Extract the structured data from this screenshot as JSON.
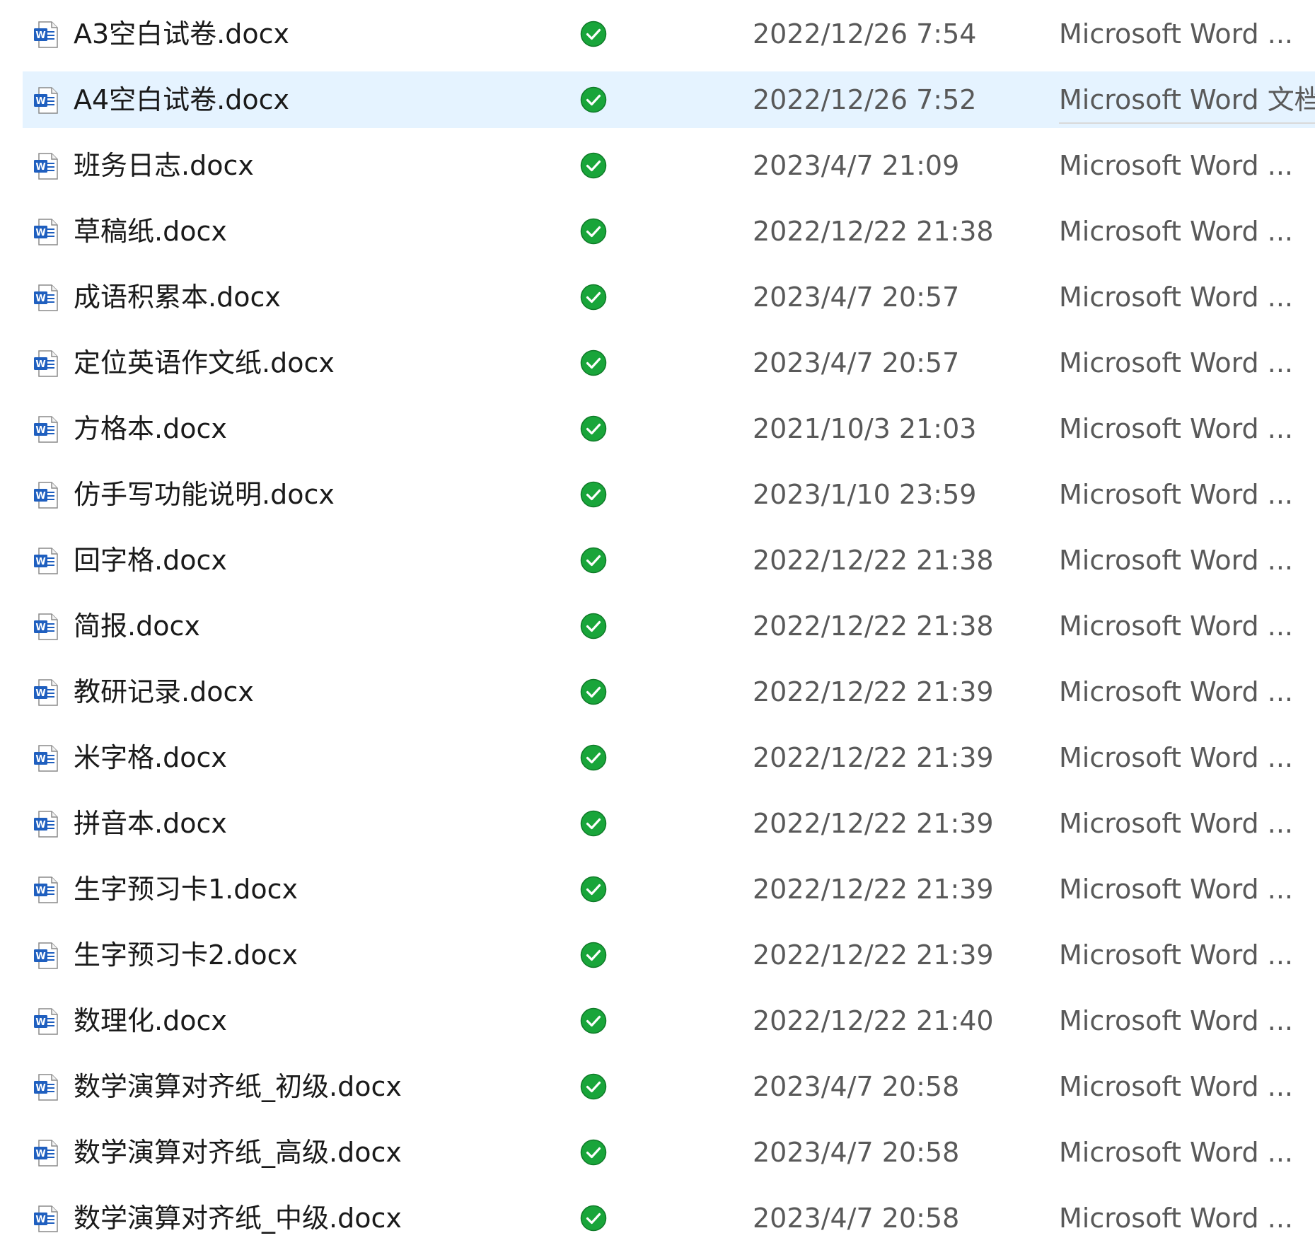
{
  "colors": {
    "selection": "#e5f3ff",
    "status_ok": "#19a53a",
    "word_blue": "#1f5fbf",
    "text": "#1a1a1a",
    "secondary_text": "#595959"
  },
  "icons": {
    "file": "word-document-icon",
    "status": "synced-check-icon"
  },
  "selected_index": 1,
  "files": [
    {
      "name": "A3空白试卷.docx",
      "modified": "2022/12/26 7:54",
      "type": "Microsoft Word ..."
    },
    {
      "name": "A4空白试卷.docx",
      "modified": "2022/12/26 7:52",
      "type": "Microsoft Word 文档"
    },
    {
      "name": "班务日志.docx",
      "modified": "2023/4/7 21:09",
      "type": "Microsoft Word ..."
    },
    {
      "name": "草稿纸.docx",
      "modified": "2022/12/22 21:38",
      "type": "Microsoft Word ..."
    },
    {
      "name": "成语积累本.docx",
      "modified": "2023/4/7 20:57",
      "type": "Microsoft Word ..."
    },
    {
      "name": "定位英语作文纸.docx",
      "modified": "2023/4/7 20:57",
      "type": "Microsoft Word ..."
    },
    {
      "name": "方格本.docx",
      "modified": "2021/10/3 21:03",
      "type": "Microsoft Word ..."
    },
    {
      "name": "仿手写功能说明.docx",
      "modified": "2023/1/10 23:59",
      "type": "Microsoft Word ..."
    },
    {
      "name": "回字格.docx",
      "modified": "2022/12/22 21:38",
      "type": "Microsoft Word ..."
    },
    {
      "name": "简报.docx",
      "modified": "2022/12/22 21:38",
      "type": "Microsoft Word ..."
    },
    {
      "name": "教研记录.docx",
      "modified": "2022/12/22 21:39",
      "type": "Microsoft Word ..."
    },
    {
      "name": "米字格.docx",
      "modified": "2022/12/22 21:39",
      "type": "Microsoft Word ..."
    },
    {
      "name": "拼音本.docx",
      "modified": "2022/12/22 21:39",
      "type": "Microsoft Word ..."
    },
    {
      "name": "生字预习卡1.docx",
      "modified": "2022/12/22 21:39",
      "type": "Microsoft Word ..."
    },
    {
      "name": "生字预习卡2.docx",
      "modified": "2022/12/22 21:39",
      "type": "Microsoft Word ..."
    },
    {
      "name": "数理化.docx",
      "modified": "2022/12/22 21:40",
      "type": "Microsoft Word ..."
    },
    {
      "name": "数学演算对齐纸_初级.docx",
      "modified": "2023/4/7 20:58",
      "type": "Microsoft Word ..."
    },
    {
      "name": "数学演算对齐纸_高级.docx",
      "modified": "2023/4/7 20:58",
      "type": "Microsoft Word ..."
    },
    {
      "name": "数学演算对齐纸_中级.docx",
      "modified": "2023/4/7 20:58",
      "type": "Microsoft Word ..."
    }
  ]
}
